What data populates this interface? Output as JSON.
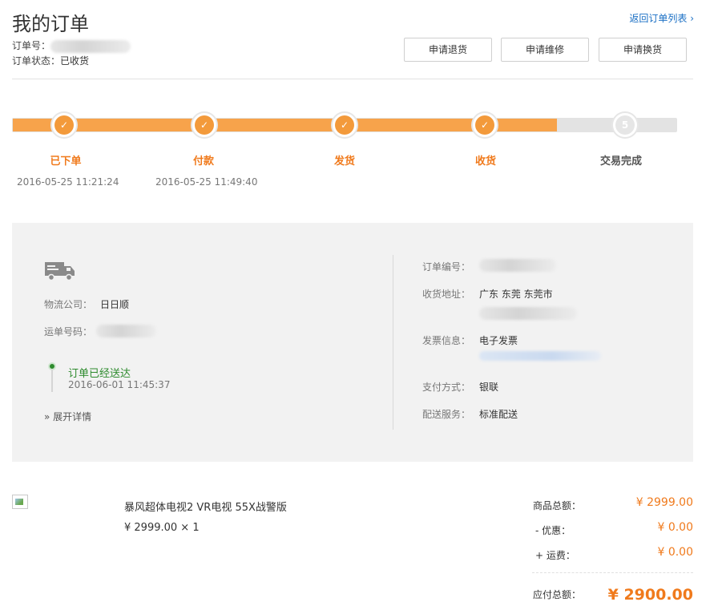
{
  "header": {
    "title": "我的订单",
    "back_link": "返回订单列表",
    "order_no_label": "订单号：",
    "order_status_label": "订单状态：",
    "order_status_value": "已收货"
  },
  "actions": {
    "return_label": "申请退货",
    "repair_label": "申请维修",
    "exchange_label": "申请换货"
  },
  "progress": {
    "completed_fraction": 0.82,
    "steps": [
      {
        "label": "已下单",
        "time": "2016-05-25 11:21:24",
        "done": true
      },
      {
        "label": "付款",
        "time": "2016-05-25 11:49:40",
        "done": true
      },
      {
        "label": "发货",
        "time": "",
        "done": true
      },
      {
        "label": "收货",
        "time": "",
        "done": true
      },
      {
        "label": "交易完成",
        "time": "",
        "done": false,
        "number": "5"
      }
    ]
  },
  "logistics": {
    "company_label": "物流公司：",
    "company_value": "日日顺",
    "tracking_label": "运单号码：",
    "status_text": "订单已经送达",
    "status_time": "2016-06-01 11:45:37",
    "expand_label": "展开详情"
  },
  "order_info": {
    "order_no_label": "订单编号：",
    "address_label": "收货地址：",
    "address_value": "广东 东莞 东莞市",
    "invoice_label": "发票信息：",
    "invoice_value": "电子发票",
    "payment_label": "支付方式：",
    "payment_value": "银联",
    "delivery_label": "配送服务：",
    "delivery_value": "标准配送"
  },
  "product": {
    "name": "暴风超体电视2 VR电视 55X战警版",
    "price_qty": "¥ 2999.00 × 1"
  },
  "summary": {
    "goods_total_label": "商品总额：",
    "goods_total_value": "¥ 2999.00",
    "discount_label": "- 优惠：",
    "discount_value": "¥ 0.00",
    "shipping_label": "+ 运费：",
    "shipping_value": "¥ 0.00",
    "payable_label": "应付总额：",
    "payable_value": "¥ 2900.00"
  },
  "colors": {
    "accent": "#f07a1c",
    "progress_fill": "#f7a34b",
    "link": "#1a6fc4",
    "delivered_green": "#2e8b2e",
    "panel_bg": "#f2f2f2"
  }
}
